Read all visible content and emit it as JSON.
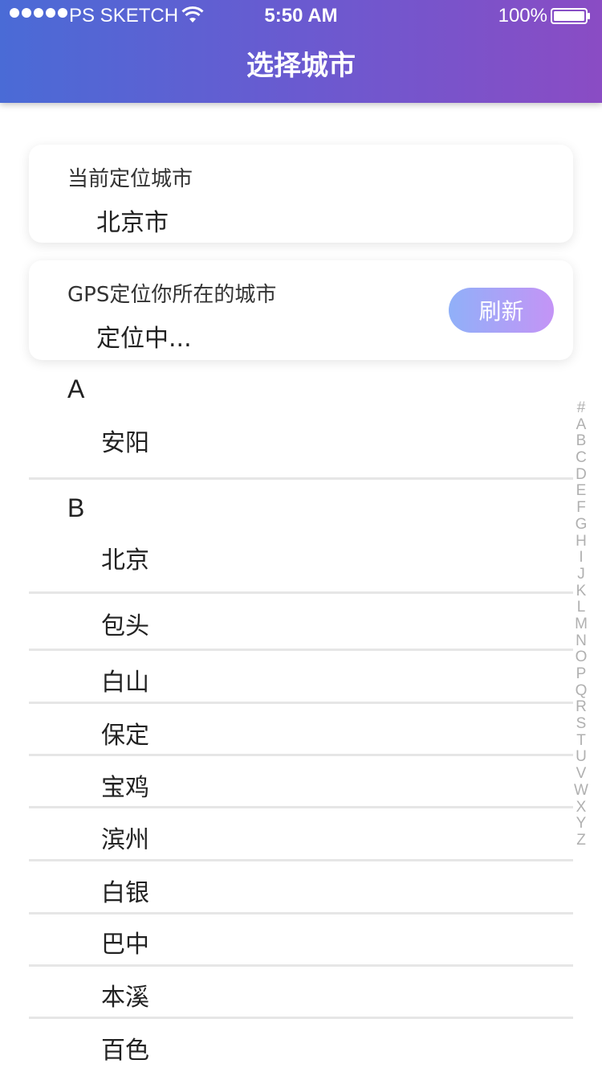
{
  "status_bar": {
    "carrier": "PS SKETCH",
    "time": "5:50 AM",
    "battery": "100%",
    "icons": [
      "signal-icon",
      "wifi-icon",
      "battery-icon"
    ]
  },
  "header": {
    "title": "选择城市"
  },
  "current_city": {
    "label": "当前定位城市",
    "value": "北京市"
  },
  "gps": {
    "label": "GPS定位你所在的城市",
    "value": "定位中...",
    "button": "刷新"
  },
  "sections": [
    {
      "letter": "A",
      "cities": [
        "安阳"
      ]
    },
    {
      "letter": "B",
      "cities": [
        "北京",
        "包头",
        "白山",
        "保定",
        "宝鸡",
        "滨州",
        "白银",
        "巴中",
        "本溪",
        "百色"
      ]
    }
  ],
  "index": [
    "#",
    "A",
    "B",
    "C",
    "D",
    "E",
    "F",
    "G",
    "H",
    "I",
    "J",
    "K",
    "L",
    "M",
    "N",
    "O",
    "P",
    "Q",
    "R",
    "S",
    "T",
    "U",
    "V",
    "W",
    "X",
    "Y",
    "Z"
  ],
  "colors": {
    "header_start": "#4a6bd6",
    "header_end": "#8a4cc4",
    "button_start": "#90b0f8",
    "button_end": "#c494f6"
  }
}
